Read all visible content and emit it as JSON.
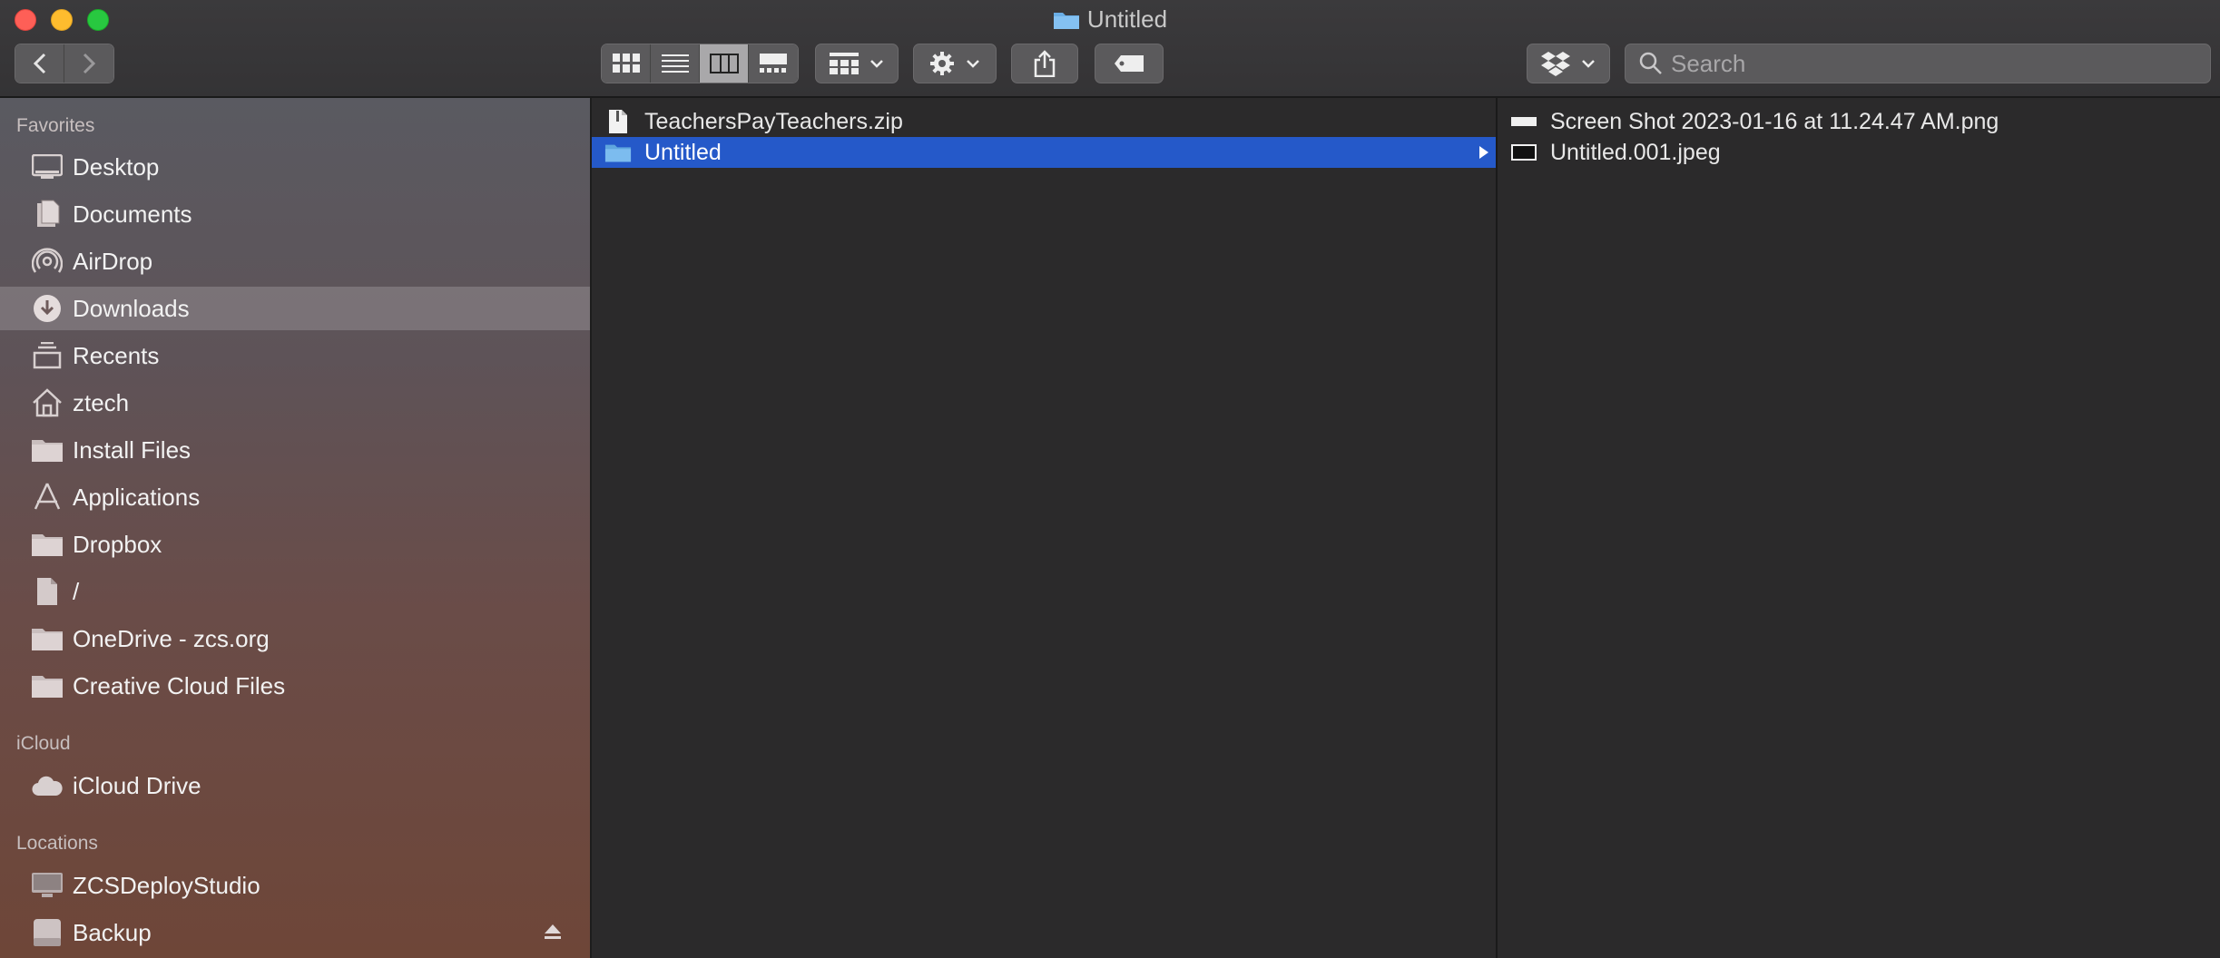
{
  "window": {
    "title": "Untitled"
  },
  "toolbar": {
    "view_modes": [
      "icon-view",
      "list-view",
      "column-view",
      "gallery-view"
    ],
    "active_view": "column-view",
    "search": {
      "placeholder": "Search",
      "value": ""
    }
  },
  "sidebar": {
    "sections": [
      {
        "title": "Favorites"
      },
      {
        "title": "iCloud"
      },
      {
        "title": "Locations"
      }
    ],
    "favorites": [
      {
        "label": "Desktop",
        "icon": "desktop-icon"
      },
      {
        "label": "Documents",
        "icon": "documents-icon"
      },
      {
        "label": "AirDrop",
        "icon": "airdrop-icon"
      },
      {
        "label": "Downloads",
        "icon": "downloads-icon",
        "selected": true
      },
      {
        "label": "Recents",
        "icon": "recents-icon"
      },
      {
        "label": "ztech",
        "icon": "home-icon"
      },
      {
        "label": "Install Files",
        "icon": "folder-icon"
      },
      {
        "label": "Applications",
        "icon": "applications-icon"
      },
      {
        "label": "Dropbox",
        "icon": "folder-icon"
      },
      {
        "label": "/",
        "icon": "document-icon"
      },
      {
        "label": "OneDrive - zcs.org",
        "icon": "folder-icon"
      },
      {
        "label": "Creative Cloud Files",
        "icon": "folder-icon"
      }
    ],
    "icloud": [
      {
        "label": "iCloud Drive",
        "icon": "cloud-icon"
      }
    ],
    "locations": [
      {
        "label": "ZCSDeployStudio",
        "icon": "computer-icon"
      },
      {
        "label": "Backup",
        "icon": "drive-icon"
      }
    ]
  },
  "columns": [
    {
      "items": [
        {
          "name": "TeachersPayTeachers.zip",
          "icon": "zip-file-icon"
        },
        {
          "name": "Untitled",
          "icon": "folder-icon",
          "selected": true
        }
      ]
    },
    {
      "items": [
        {
          "name": "Screen Shot 2023-01-16 at 11.24.47 AM.png",
          "icon": "image-file-icon"
        },
        {
          "name": "Untitled.001.jpeg",
          "icon": "image-file-icon"
        }
      ]
    }
  ],
  "colors": {
    "selection": "#2559c9",
    "background": "#2b2a2b"
  }
}
